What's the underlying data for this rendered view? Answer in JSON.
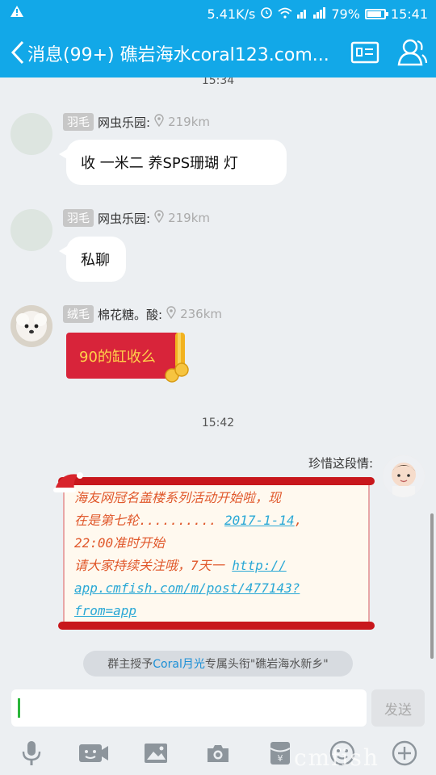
{
  "statusbar": {
    "warning_icon": "warning-icon",
    "net_speed": "5.41K/s",
    "battery_text": "79%",
    "battery_level": 0.79,
    "time": "15:41"
  },
  "titlebar": {
    "title": "消息(99+) 礁岩海水coral123.com...",
    "back_icon": "chevron-left-icon",
    "card_icon": "id-card-icon",
    "members_icon": "people-icon"
  },
  "chat": {
    "top_time": "15:34",
    "mid_time": "15:42",
    "messages": [
      {
        "badge": "羽毛",
        "name": "网虫乐园:",
        "distance": "219km",
        "text": "收  一米二  养SPS珊瑚  灯"
      },
      {
        "badge": "羽毛",
        "name": "网虫乐园:",
        "distance": "219km",
        "text": "私聊"
      },
      {
        "badge": "绒毛",
        "name": "棉花糖。酸:",
        "distance": "236km",
        "text": "90的缸收么"
      }
    ],
    "right_message": {
      "name": "珍惜这段情:",
      "lines": [
        "海友网冠名盖楼系列活动开始啦，现",
        "在是第七轮.........."
      ],
      "date_link": "2017-1-14",
      "line3": "22:00准时开始",
      "line4": "请大家持续关注哦，7天一",
      "url_part1": "http://",
      "url_part2": "app.cmfish.com/m/post/477143?",
      "url_part3": "from=app"
    },
    "system_note": {
      "prefix": "群主授予 ",
      "highlight": "Coral月光",
      "suffix": " 专属头衔\"礁岩海水新乡\""
    }
  },
  "input": {
    "placeholder": "",
    "send_label": "发送"
  },
  "toolbar": {
    "icons": [
      "microphone-icon",
      "video-icon",
      "image-icon",
      "camera-icon",
      "red-packet-icon",
      "emoji-icon",
      "plus-icon"
    ]
  },
  "watermark": "cmfish"
}
